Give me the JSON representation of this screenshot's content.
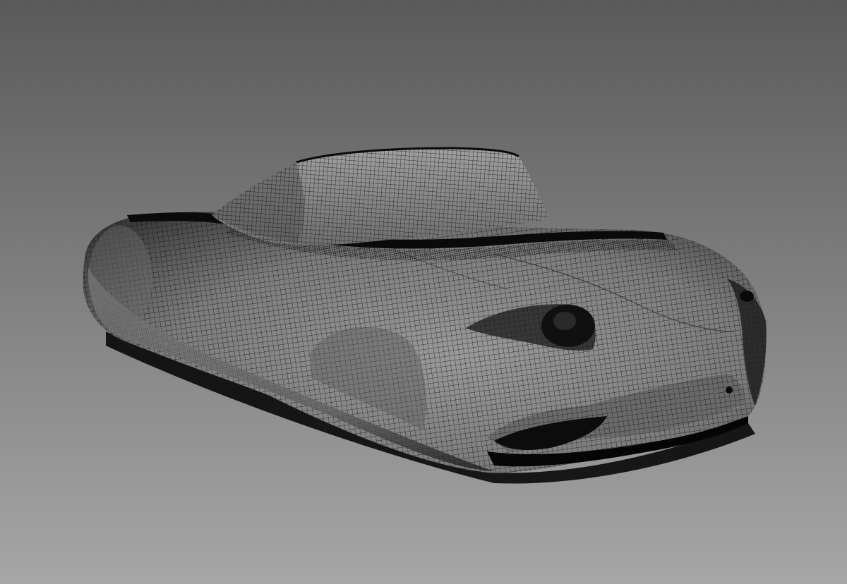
{
  "viewport": {
    "background_top": "#5a5a5a",
    "background_bottom": "#a6a6a6"
  },
  "model": {
    "name": "car-body-mesh",
    "render_mode": "wireframe-on-shaded",
    "surface_color": "#8a8a8a",
    "wire_color": "#141414",
    "shadow_color": "#000000"
  }
}
